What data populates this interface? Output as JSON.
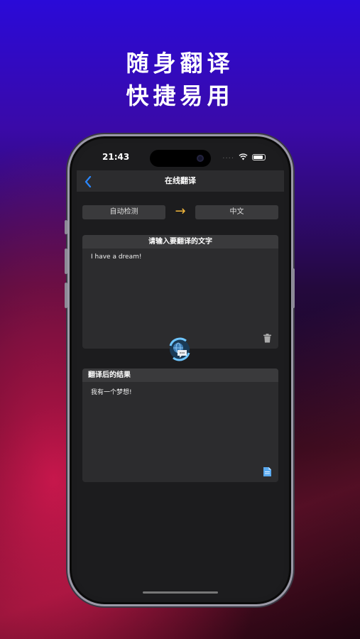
{
  "promo": {
    "line1": "随身翻译",
    "line2": "快捷易用"
  },
  "status_bar": {
    "time": "21:43",
    "dots": "....",
    "icons": [
      "wifi-icon",
      "battery-icon"
    ]
  },
  "nav": {
    "back_icon": "chevron-left-icon",
    "title": "在线翻译"
  },
  "languages": {
    "source": "自动检测",
    "swap_icon": "arrow-right-icon",
    "swap_symbol": "→",
    "target": "中文"
  },
  "input_card": {
    "header": "请输入要翻译的文字",
    "text": "I have a dream!",
    "action_icon": "trash-icon"
  },
  "translate_button": {
    "icon": "translate-icon"
  },
  "output_card": {
    "header": "翻译后的结果",
    "text": "我有一个梦想!",
    "action_icon": "copy-icon"
  },
  "colors": {
    "accent": "#2a87ff",
    "arrow": "#f4b83c",
    "screen_bg": "#1c1c1e",
    "card_bg": "#2c2c2e"
  }
}
